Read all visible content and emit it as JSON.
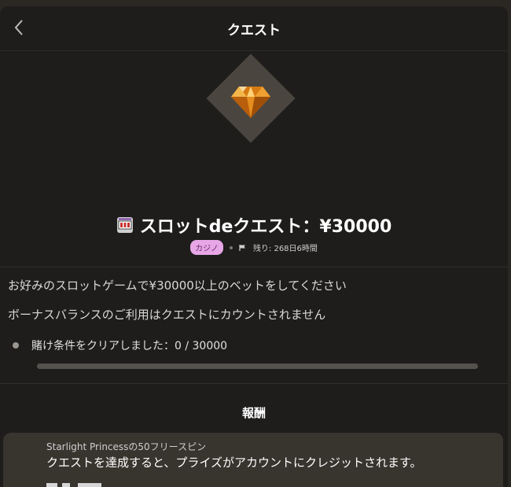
{
  "header": {
    "title": "クエスト",
    "back_icon": "chevron-left-icon"
  },
  "quest": {
    "icon": "slot-machine-icon",
    "title": "スロットdeクエスト：¥30000",
    "category": "カジノ",
    "remaining": "残り: 268日6時間",
    "description_1": "お好みのスロットゲームで¥30000以上のベットをしてください",
    "description_2": "ボーナスバランスのご利用はクエストにカウントされません",
    "condition": "賭け条件をクリアしました：0 / 30000",
    "progress_fraction": 0
  },
  "reward": {
    "section_title": "報酬",
    "name": "Starlight Princessの50フリースピン",
    "description": "クエストを達成すると、プライズがアカウントにクレジットされます。"
  },
  "colors": {
    "panel": "#1e1d1c",
    "badge_bg": "#e7a6e6",
    "gem": "#e08a1e"
  }
}
